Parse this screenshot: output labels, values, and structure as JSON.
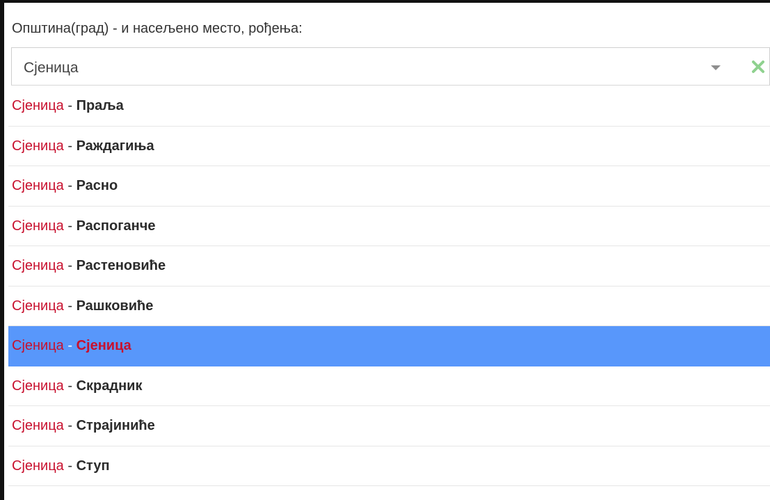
{
  "field": {
    "label": "Општина(град) - и насељено место, рођења:",
    "selected_value": "Сјеница"
  },
  "icons": {
    "dropdown": "chevron-down-icon",
    "clear": "clear-x-icon",
    "clear_color": "#8fd18f"
  },
  "options": [
    {
      "city": "Сјеница",
      "sep": " - ",
      "place": "Прaља"
    },
    {
      "city": "Сјеница",
      "sep": " - ",
      "place": "Раждагиња"
    },
    {
      "city": "Сјеница",
      "sep": " - ",
      "place": "Расно"
    },
    {
      "city": "Сјеница",
      "sep": " - ",
      "place": "Распоганче"
    },
    {
      "city": "Сјеница",
      "sep": " - ",
      "place": "Растеновиће"
    },
    {
      "city": "Сјеница",
      "sep": " - ",
      "place": "Рашковиће"
    },
    {
      "city": "Сјеница",
      "sep": " - ",
      "place": "Сјеница"
    },
    {
      "city": "Сјеница",
      "sep": " - ",
      "place": "Скрадник"
    },
    {
      "city": "Сјеница",
      "sep": " - ",
      "place": "Страјиниће"
    },
    {
      "city": "Сјеница",
      "sep": " - ",
      "place": "Ступ"
    }
  ],
  "highlighted_index": 6,
  "colors": {
    "city_text": "#c8102e",
    "highlight_bg": "#5897fb"
  }
}
